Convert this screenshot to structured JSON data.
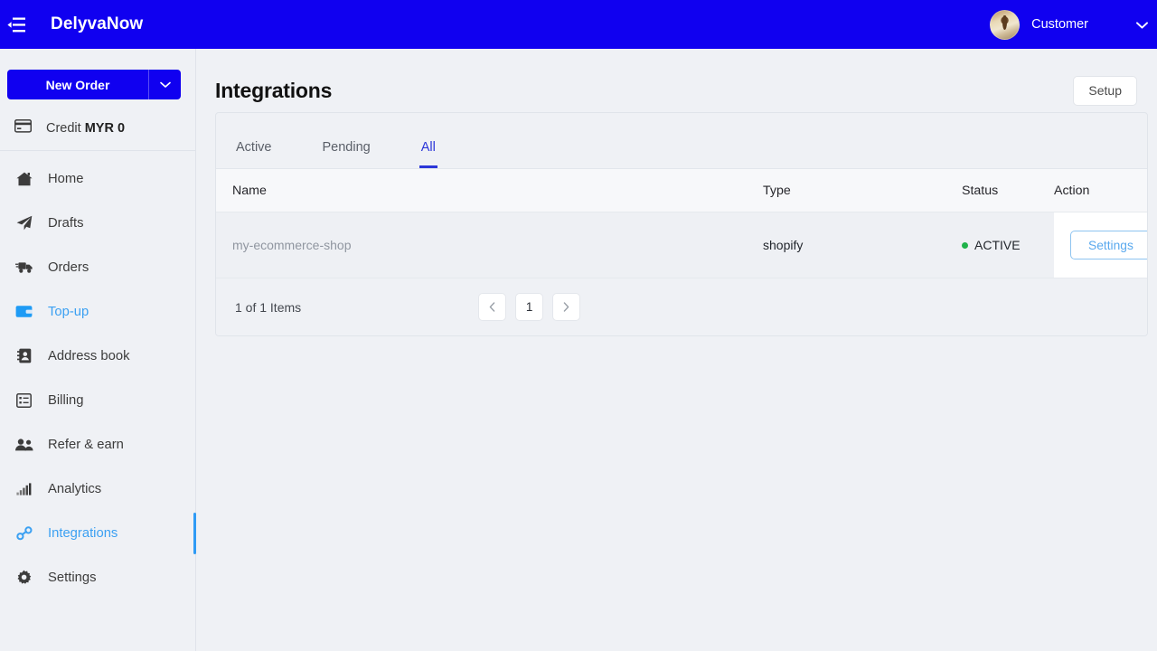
{
  "topbar": {
    "menu_icon": "menu-fold-icon",
    "brand": "DelyvaNow",
    "user_name": "Customer",
    "caret_icon": "chevron-down-icon",
    "avatar_icon": "user-avatar",
    "bg_color": "#1000f0"
  },
  "sidebar": {
    "new_order": {
      "label": "New Order",
      "dropdown_icon": "chevron-down-icon"
    },
    "credit": {
      "icon": "credit-card-icon",
      "label": "Credit",
      "amount": "MYR 0"
    },
    "items": [
      {
        "label": "Home",
        "icon": "home-icon",
        "state": "default"
      },
      {
        "label": "Drafts",
        "icon": "paper-plane-icon",
        "state": "default"
      },
      {
        "label": "Orders",
        "icon": "truck-icon",
        "state": "default"
      },
      {
        "label": "Top-up",
        "icon": "wallet-icon",
        "state": "hovered"
      },
      {
        "label": "Address book",
        "icon": "contact-book-icon",
        "state": "default"
      },
      {
        "label": "Billing",
        "icon": "invoice-icon",
        "state": "default"
      },
      {
        "label": "Refer & earn",
        "icon": "people-icon",
        "state": "default"
      },
      {
        "label": "Analytics",
        "icon": "bar-chart-icon",
        "state": "default"
      },
      {
        "label": "Integrations",
        "icon": "link-chain-icon",
        "state": "active"
      },
      {
        "label": "Settings",
        "icon": "gear-icon",
        "state": "default"
      }
    ],
    "accent_color": "#3ba0f2"
  },
  "main": {
    "page_title": "Integrations",
    "setup_label": "Setup",
    "tabs": [
      {
        "label": "Active",
        "active": false
      },
      {
        "label": "Pending",
        "active": false
      },
      {
        "label": "All",
        "active": true
      }
    ],
    "tab_active_color": "#2b36d8",
    "table": {
      "headers": [
        "Name",
        "Type",
        "Status",
        "Action"
      ],
      "rows": [
        {
          "name": "my-ecommerce-shop",
          "type": "shopify",
          "status": "ACTIVE",
          "status_color": "#1fb24a",
          "action_label": "Settings"
        }
      ]
    },
    "pagination": {
      "info": "1 of 1 Items",
      "prev_icon": "chevron-left-icon",
      "next_icon": "chevron-right-icon",
      "current_page": "1"
    }
  }
}
